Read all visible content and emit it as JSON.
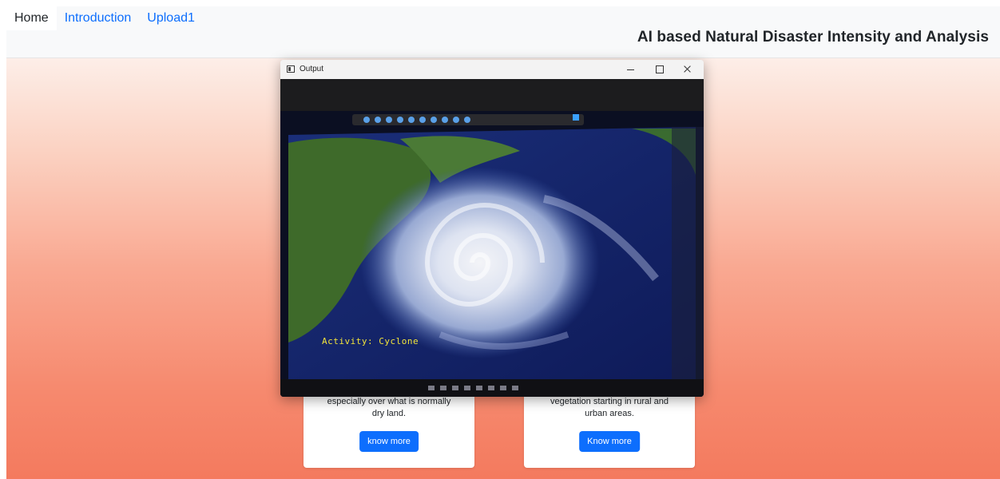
{
  "nav": {
    "tabs": [
      {
        "label": "Home",
        "active": true
      },
      {
        "label": "Introduction",
        "active": false
      },
      {
        "label": "Upload1",
        "active": false
      }
    ],
    "brand": "AI based Natural Disaster Intensity and Analysis"
  },
  "cards": [
    {
      "text_line1": "especially over what is normally",
      "text_line2": "dry land.",
      "button": "know more"
    },
    {
      "text_line1": "vegetation starting in rural and",
      "text_line2": "urban areas.",
      "button": "Know more"
    }
  ],
  "output_window": {
    "title": "Output",
    "activity_label": "Activity: Cyclone"
  },
  "colors": {
    "primary": "#0d6efd",
    "hero_top": "#fdeee8",
    "hero_bottom": "#f47a5e",
    "activity_text": "#f3e53a"
  }
}
